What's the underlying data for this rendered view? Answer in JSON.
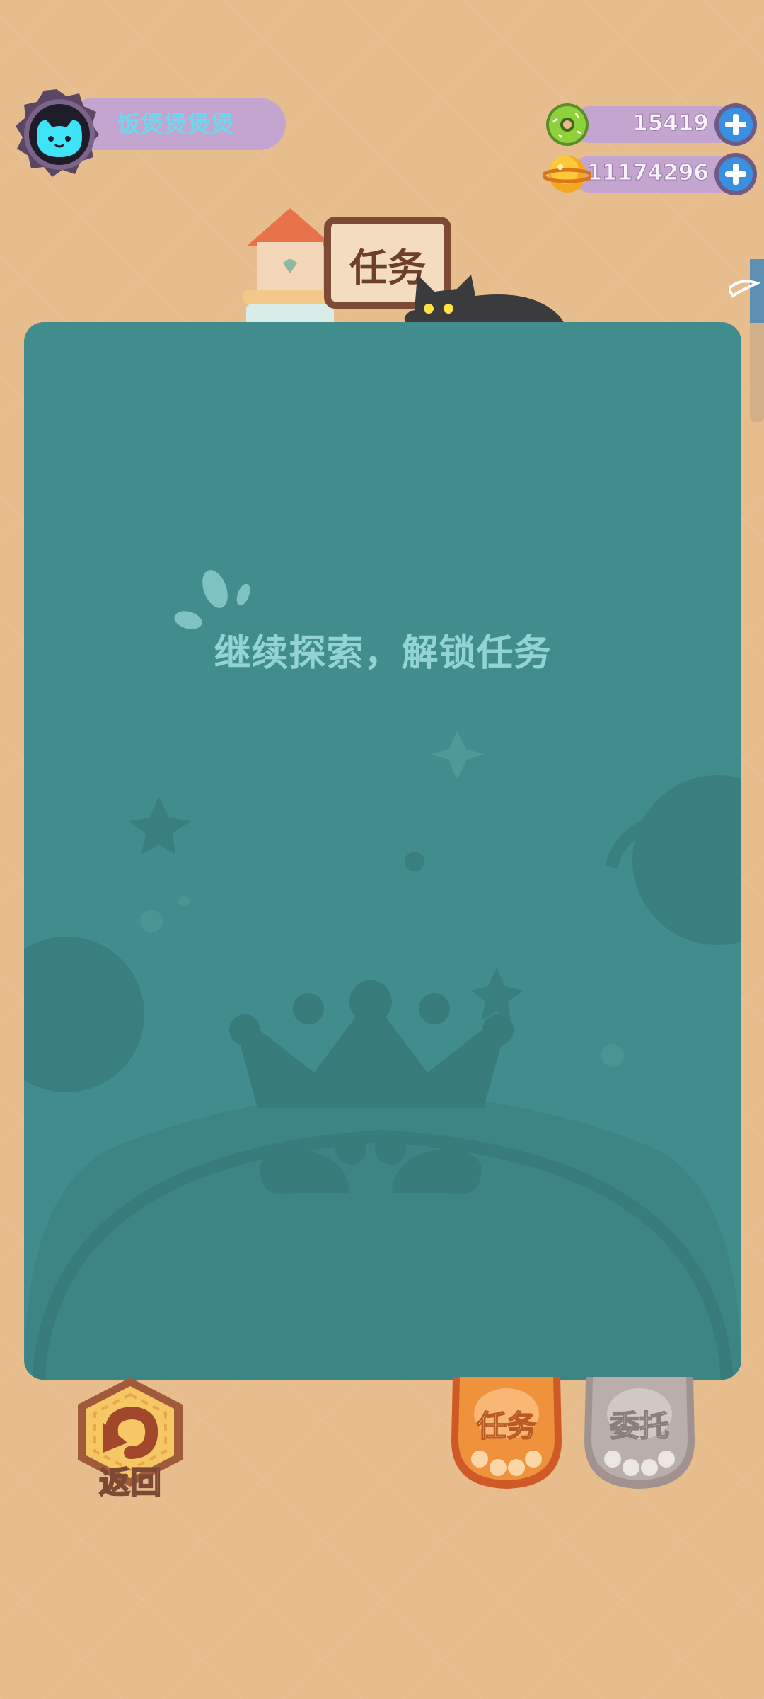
{
  "player": {
    "name": "饭煲煲煲煲"
  },
  "currencies": [
    {
      "icon": "green-donut-icon",
      "value": "15419"
    },
    {
      "icon": "gold-planet-icon",
      "value": "11174296"
    }
  ],
  "header": {
    "sign_title": "任务"
  },
  "panel": {
    "empty_message": "继续探索，解锁任务"
  },
  "bottom": {
    "back_label": "返回",
    "tabs": [
      {
        "label": "任务",
        "active": true
      },
      {
        "label": "委托",
        "active": false
      }
    ]
  },
  "colors": {
    "background": "#e8bd8e",
    "panel": "#418c8c",
    "pill": "#c3a5cf",
    "accent_blue": "#3b8fe0",
    "task_orange": "#f0923c",
    "entrust_gray": "#b9aeab"
  }
}
